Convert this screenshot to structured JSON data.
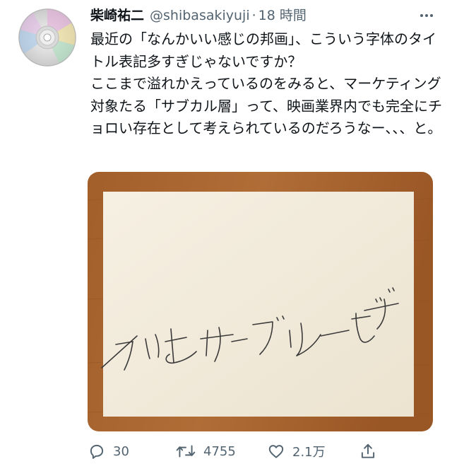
{
  "author": {
    "display_name": "柴崎祐二",
    "handle": "@shibasakiyuji",
    "separator": "·",
    "time": "18 時間"
  },
  "tweet": {
    "text": "最近の「なんかいい感じの邦画」、こういう字体のタイトル表記多すぎじゃないですか？\nここまで溢れかえっているのをみると、マーケティング対象たる「サブカル層」って、映画業界内でも完全にチョロい存在として考えられているのだろうなー、、、と。"
  },
  "media": {
    "handwriting": "これはサンプルです",
    "colors": {
      "table": "#a0622f",
      "paper": "#f3ecde",
      "ink": "#3a3a3a"
    }
  },
  "actions": {
    "reply_count": "30",
    "retweet_count": "4755",
    "like_count": "2.1万"
  },
  "icons": {
    "avatar": "cd-disc-icon",
    "more": "more-dots-icon",
    "reply": "reply-bubble-icon",
    "retweet": "retweet-icon",
    "like": "heart-icon",
    "share": "share-upload-icon"
  },
  "colors": {
    "text": "#0f1419",
    "secondary": "#536471"
  }
}
